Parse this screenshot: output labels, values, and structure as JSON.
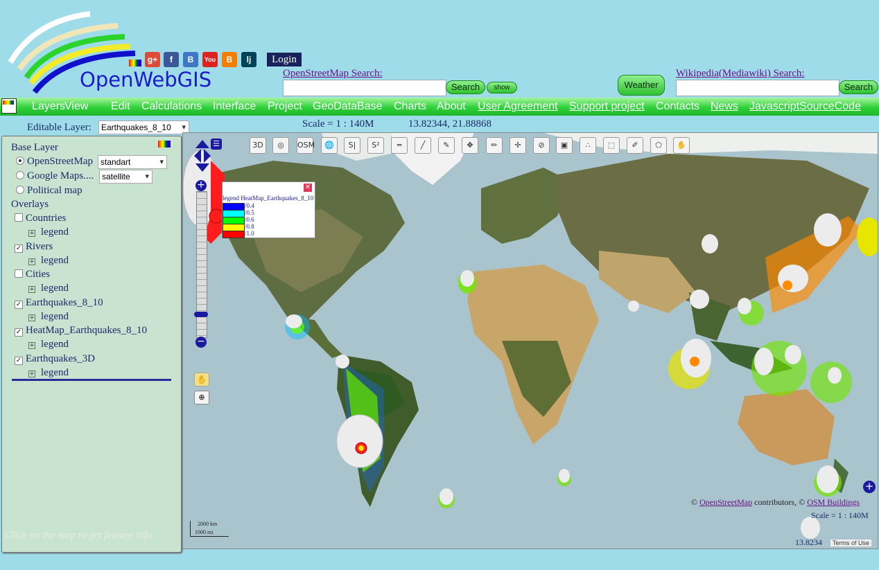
{
  "brand": {
    "name": "OpenWebGIS"
  },
  "header": {
    "login_label": "Login",
    "osm_search": {
      "label": "OpenStreetMap  Search:",
      "value": "",
      "button": "Search",
      "show_button": "show"
    },
    "weather_button": "Weather",
    "wiki_search": {
      "label": "Wikipedia(Mediawiki)  Search:",
      "value": "",
      "button": "Search"
    },
    "social_icons": [
      "google-plus-icon",
      "facebook-icon",
      "vk-icon",
      "youtube-icon",
      "blogger-icon",
      "livejournal-icon"
    ]
  },
  "menu": [
    {
      "label": "Layers",
      "underline": false
    },
    {
      "label": "View",
      "underline": false
    },
    {
      "label": "Edit",
      "underline": false
    },
    {
      "label": "Calculations",
      "underline": false
    },
    {
      "label": "Interface",
      "underline": false
    },
    {
      "label": "Project",
      "underline": false
    },
    {
      "label": "GeoDataBase",
      "underline": false
    },
    {
      "label": "Charts",
      "underline": false
    },
    {
      "label": "About",
      "underline": false
    },
    {
      "label": "User Agreement",
      "underline": true
    },
    {
      "label": "Support project",
      "underline": true
    },
    {
      "label": "Contacts",
      "underline": false
    },
    {
      "label": "News",
      "underline": true
    },
    {
      "label": "JavascriptSourceCode",
      "underline": true
    }
  ],
  "status": {
    "editable_layer_label": "Editable Layer:",
    "editable_layer_value": "Earthquakes_8_10",
    "scale": "Scale = 1 : 140M",
    "coords": "13.82344, 21.88868"
  },
  "layers_panel": {
    "base_layer_title": "Base Layer",
    "base_layers": [
      {
        "label": "OpenStreetMap",
        "selected": true,
        "option": "standart"
      },
      {
        "label": "Google Maps....",
        "selected": false,
        "option": "satellite"
      },
      {
        "label": "Political map",
        "selected": false,
        "option": ""
      }
    ],
    "overlays_title": "Overlays",
    "overlays": [
      {
        "label": "Countries",
        "checked": false,
        "legend": "legend"
      },
      {
        "label": "Rivers",
        "checked": true,
        "legend": "legend"
      },
      {
        "label": "Cities",
        "checked": false,
        "legend": "legend"
      },
      {
        "label": "Earthquakes_8_10",
        "checked": true,
        "legend": "legend"
      },
      {
        "label": "HeatMap_Earthquakes_8_10",
        "checked": true,
        "legend": "legend"
      },
      {
        "label": "Earthquakes_3D",
        "checked": true,
        "legend": "legend"
      }
    ],
    "hint": "Click on the map to get feature info"
  },
  "map": {
    "toolbar": [
      "3D",
      "target-icon",
      "OSM",
      "globe-icon",
      "S|",
      "S²",
      "ruler-icon",
      "draw-line-icon",
      "pencil-icon",
      "move-icon",
      "edit-icon",
      "drag-icon",
      "delete-icon",
      "save-icon",
      "points-icon",
      "select-box-icon",
      "modify-icon",
      "polygon-icon",
      "hand-icon"
    ],
    "legend_popup": {
      "title": "legend HeatMap_Earthquakes_8_10",
      "entries": [
        {
          "label": "/0.4",
          "color": "#0000ff"
        },
        {
          "label": "/0.5",
          "color": "#00ffff"
        },
        {
          "label": "/0.6",
          "color": "#00ff00"
        },
        {
          "label": "/0.8",
          "color": "#ffff00"
        },
        {
          "label": "/1.0",
          "color": "#ff0000"
        }
      ]
    },
    "attribution": {
      "osm": "OpenStreetMap",
      "middle": " contributors, ©",
      "buildings": "OSM Buildings",
      "prefix": "© "
    },
    "scale_text": "Scale = 1 : 140M",
    "coords_text": "13.8234",
    "scale_bar": {
      "km": "2000 km",
      "mi": "1000 mi"
    },
    "terms": "Terms of Use"
  }
}
